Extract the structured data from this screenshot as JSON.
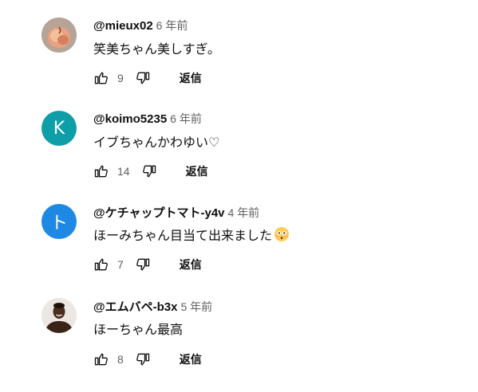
{
  "comments": [
    {
      "author": "@mieux02",
      "time": "6 年前",
      "text": "笑美ちゃん美しすぎ。",
      "likes": "9",
      "reply_label": "返信",
      "avatar": {
        "type": "image",
        "icon": "peach-photo-avatar"
      }
    },
    {
      "author": "@koimo5235",
      "time": "6 年前",
      "text": "イブちゃんかわゆい♡",
      "likes": "14",
      "reply_label": "返信",
      "avatar": {
        "type": "letter",
        "letter": "K",
        "color": "#0d9ea8"
      }
    },
    {
      "author": "@ケチャップトマト-y4v",
      "time": "4 年前",
      "text": "ほーみちゃん目当て出来ました",
      "emoji": "flushed-face-emoji",
      "likes": "7",
      "reply_label": "返信",
      "avatar": {
        "type": "letter",
        "letter": "ト",
        "color": "#1e88e5"
      }
    },
    {
      "author": "@エムバペ-b3x",
      "time": "5 年前",
      "text": "ほーちゃん最高",
      "likes": "8",
      "reply_label": "返信",
      "avatar": {
        "type": "image",
        "icon": "person-photo-avatar"
      }
    }
  ]
}
